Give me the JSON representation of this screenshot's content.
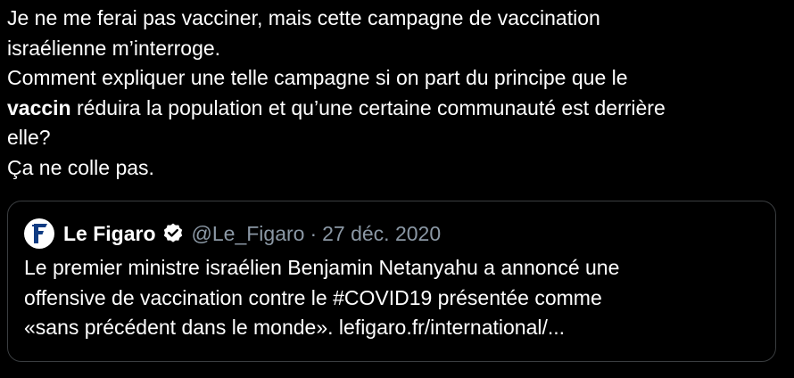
{
  "tweet": {
    "lines": [
      {
        "text": "Je ne me ferai pas vacciner, mais cette campagne de vaccination"
      },
      {
        "text": "israélienne m’interroge."
      },
      {
        "text": "Comment expliquer une telle campagne si on part du principe que le"
      },
      {
        "bold": "vaccin",
        "text": " réduira la population et qu’une certaine communauté est derrière"
      },
      {
        "text": "elle?"
      },
      {
        "text": "Ça ne colle pas."
      }
    ]
  },
  "quoted": {
    "avatar_icon": "le-figaro-logo-icon",
    "name": "Le Figaro",
    "verified_icon": "verified-badge-icon",
    "handle": "@Le_Figaro",
    "separator": "·",
    "date": "27 déc. 2020",
    "lines": [
      "Le premier ministre israélien Benjamin Netanyahu a annoncé une",
      "offensive de vaccination contre le #COVID19 présentée comme",
      "«sans précédent dans le monde». lefigaro.fr/international/..."
    ]
  },
  "colors": {
    "background": "#000000",
    "text": "#ffffff",
    "secondary_text": "#8b98a5",
    "border": "#3a3d40",
    "figaro_blue": "#0f3b82"
  }
}
